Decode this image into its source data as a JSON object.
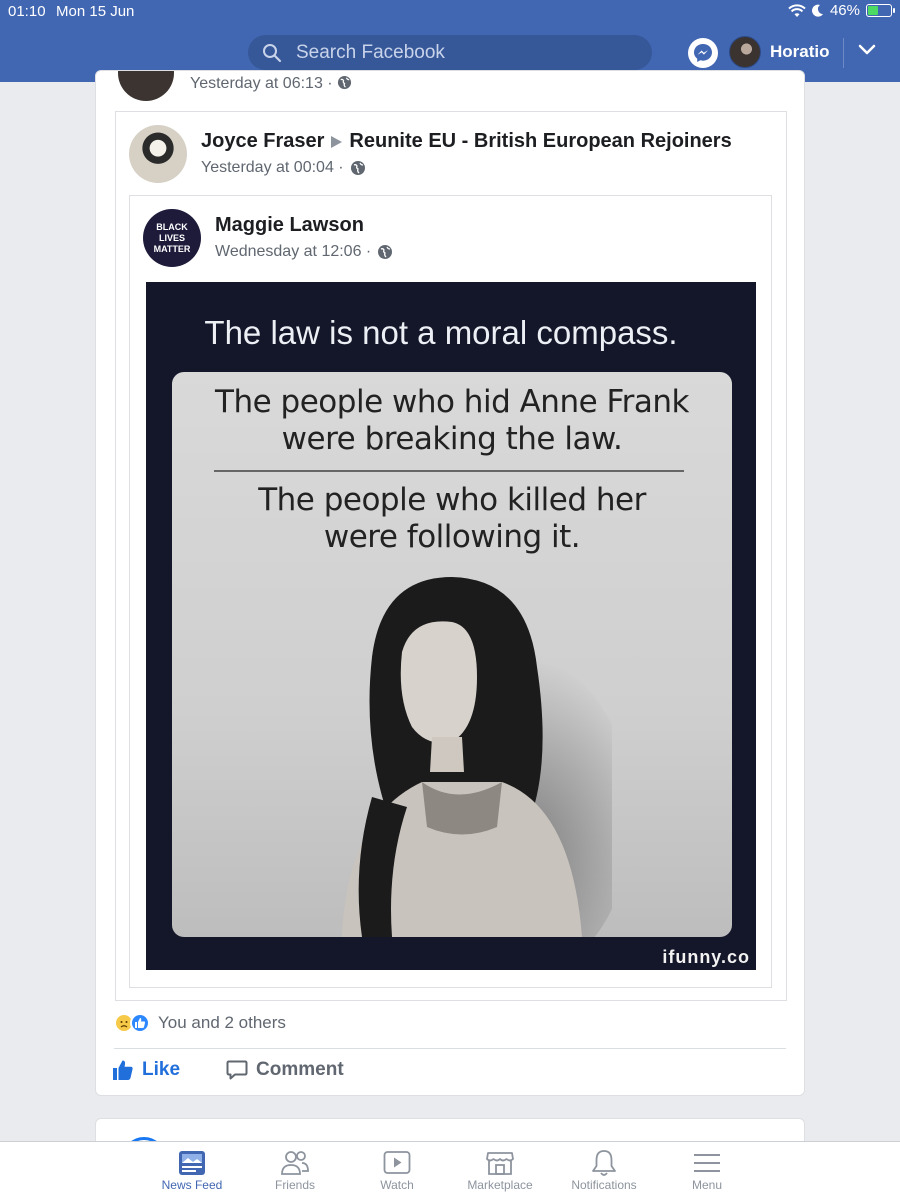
{
  "status_bar": {
    "time": "01:10",
    "date": "Mon 15 Jun",
    "battery": "46%",
    "battery_level": 0.46
  },
  "header": {
    "search_placeholder": "Search Facebook",
    "user_name": "Horatio"
  },
  "previous_post": {
    "meta": "Yesterday at 06:13 ·"
  },
  "post": {
    "author": "Joyce Fraser",
    "group": "Reunite EU - British European Rejoiners",
    "meta": "Yesterday at 00:04 ·",
    "shared": {
      "author": "Maggie Lawson",
      "avatar_text": [
        "BLACK",
        "LIVES",
        "MATTER"
      ],
      "meta": "Wednesday at 12:06 ·",
      "image": {
        "headline": "The law is not a moral compass.",
        "line1": "The people who hid Anne Frank",
        "line2": "were breaking the law.",
        "line3": "The people who killed her",
        "line4": "were following it.",
        "watermark": "ifunny.co"
      }
    },
    "reactions": {
      "text": "You and 2 others",
      "icons": [
        "sad-emoji",
        "like-thumb"
      ]
    },
    "actions": {
      "like": "Like",
      "comment": "Comment"
    }
  },
  "bottom_nav": [
    {
      "label": "News Feed",
      "icon": "news-feed-icon",
      "active": true
    },
    {
      "label": "Friends",
      "icon": "friends-icon",
      "active": false
    },
    {
      "label": "Watch",
      "icon": "watch-icon",
      "active": false
    },
    {
      "label": "Marketplace",
      "icon": "marketplace-icon",
      "active": false
    },
    {
      "label": "Notifications",
      "icon": "bell-icon",
      "active": false
    },
    {
      "label": "Menu",
      "icon": "menu-icon",
      "active": false
    }
  ],
  "colors": {
    "brand": "#4267b2",
    "accent": "#216fdb",
    "background": "#e9ebee"
  }
}
